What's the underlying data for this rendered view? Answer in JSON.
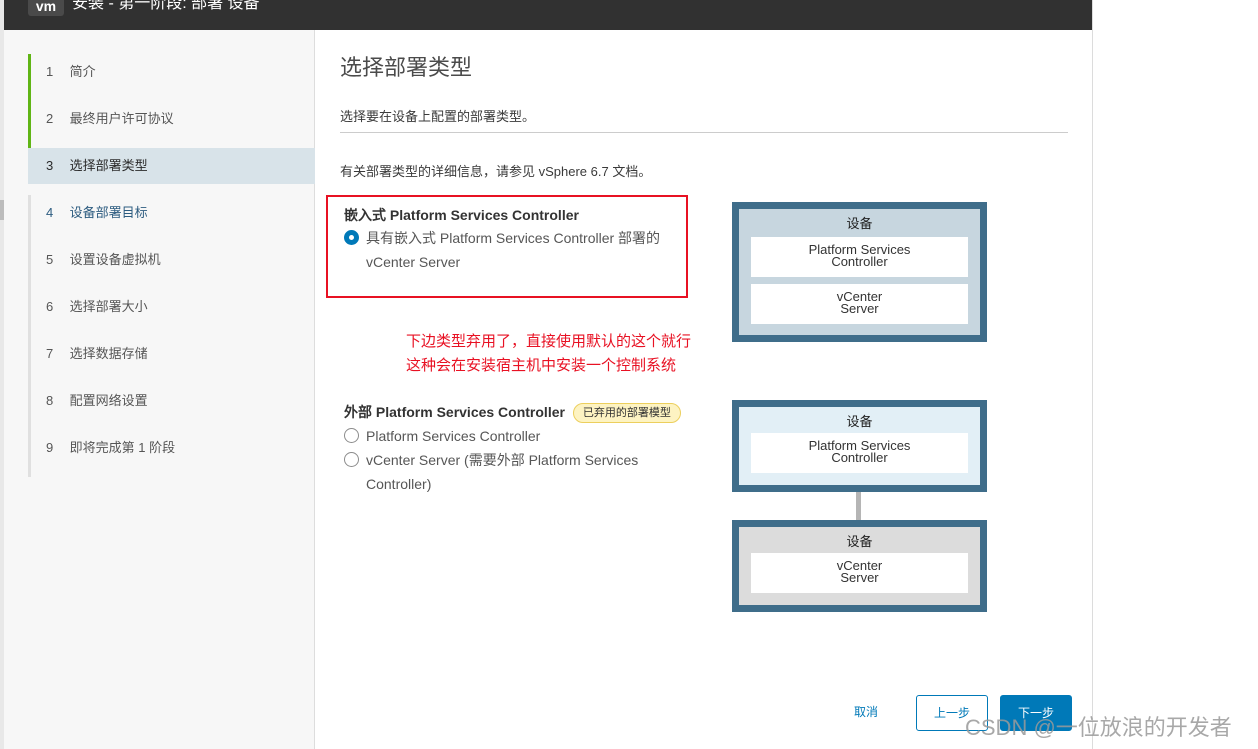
{
  "window": {
    "logo": "vm",
    "title": "安装 - 第一阶段: 部署 设备"
  },
  "sidebar": {
    "steps": [
      {
        "num": "1",
        "label": "简介"
      },
      {
        "num": "2",
        "label": "最终用户许可协议"
      },
      {
        "num": "3",
        "label": "选择部署类型"
      },
      {
        "num": "4",
        "label": "设备部署目标"
      },
      {
        "num": "5",
        "label": "设置设备虚拟机"
      },
      {
        "num": "6",
        "label": "选择部署大小"
      },
      {
        "num": "7",
        "label": "选择数据存储"
      },
      {
        "num": "8",
        "label": "配置网络设置"
      },
      {
        "num": "9",
        "label": "即将完成第 1 阶段"
      }
    ]
  },
  "main": {
    "title": "选择部署类型",
    "subtitle": "选择要在设备上配置的部署类型。",
    "info": "有关部署类型的详细信息，请参见 vSphere 6.7 文档。",
    "embedded": {
      "title": "嵌入式 Platform Services Controller",
      "option_line1": "具有嵌入式 Platform Services Controller 部署的",
      "option_line2": "vCenter Server"
    },
    "annotation": {
      "line1": "下边类型弃用了，直接使用默认的这个就行",
      "line2": "这种会在安装宿主机中安装一个控制系统"
    },
    "external": {
      "title": "外部 Platform Services Controller",
      "badge": "已弃用的部署模型",
      "option1": "Platform Services Controller",
      "option2_line1": "vCenter Server (需要外部 Platform Services",
      "option2_line2": "Controller)"
    },
    "diagram_embedded": {
      "title": "设备",
      "box1_line1": "Platform Services",
      "box1_line2": "Controller",
      "box2_line1": "vCenter",
      "box2_line2": "Server"
    },
    "diagram_external_psc": {
      "title": "设备",
      "box_line1": "Platform Services",
      "box_line2": "Controller"
    },
    "diagram_external_vc": {
      "title": "设备",
      "box_line1": "vCenter",
      "box_line2": "Server"
    }
  },
  "footer": {
    "cancel": "取消",
    "back": "上一步",
    "next": "下一步"
  },
  "watermark": "CSDN @一位放浪的开发者",
  "colors": {
    "accent": "#0079b8",
    "done": "#60b515",
    "annotation": "#e81123",
    "diagram_border": "#3f6d8a"
  }
}
